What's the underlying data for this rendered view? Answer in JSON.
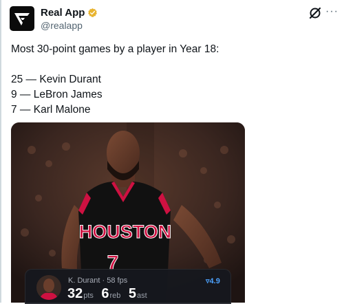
{
  "account": {
    "display_name": "Real App",
    "handle": "@realapp",
    "verified": true,
    "verified_color": "#e8b430"
  },
  "actions": {
    "grok_icon": "grok-icon",
    "more_label": "···"
  },
  "tweet": {
    "headline": "Most 30-point games by a player in Year 18:",
    "lines": [
      "25 — Kevin Durant",
      "9 — LeBron James",
      "7 — Karl Malone"
    ]
  },
  "media": {
    "jersey_team": "HOUSTON",
    "jersey_number": "7",
    "jersey_color": "#111111",
    "accent_color": "#ce1141"
  },
  "overlay": {
    "player_line": "K. Durant · 58 fps",
    "rating": "4.9",
    "rating_icon": "trend-down-icon",
    "pts_value": "32",
    "pts_unit": "pts",
    "reb_value": "6",
    "reb_unit": "reb",
    "ast_value": "5",
    "ast_unit": "ast"
  }
}
